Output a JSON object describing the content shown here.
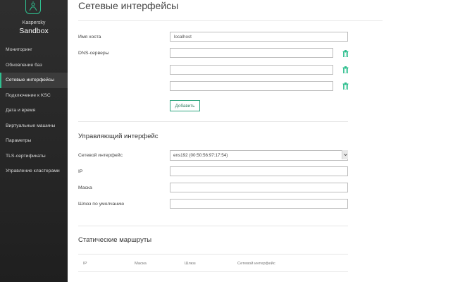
{
  "brand": {
    "company": "Kaspersky",
    "product": "Sandbox",
    "accent": "#2fbf8f"
  },
  "sidebar": {
    "items": [
      {
        "label": "Мониторинг"
      },
      {
        "label": "Обновление баз"
      },
      {
        "label": "Сетевые интерфейсы",
        "active": true
      },
      {
        "label": "Подключение к KSC"
      },
      {
        "label": "Дата и время"
      },
      {
        "label": "Виртуальные машины"
      },
      {
        "label": "Параметры"
      },
      {
        "label": "TLS-сертификаты"
      },
      {
        "label": "Управление кластерами"
      }
    ]
  },
  "page": {
    "title": "Сетевые интерфейсы"
  },
  "hostname": {
    "label": "Имя хоста",
    "value": "localhost"
  },
  "dns": {
    "label": "DNS-серверы",
    "fields": [
      "",
      "",
      ""
    ],
    "add_button": "Добавить"
  },
  "mgmt": {
    "title": "Управляющий интерфейс",
    "iface_label": "Сетевой интерфейс",
    "iface_value": "ens192 (00:50:56:97:17:54)",
    "ip_label": "IP",
    "ip_value": "",
    "mask_label": "Маска",
    "mask_value": "",
    "gateway_label": "Шлюз по умолчанию",
    "gateway_value": ""
  },
  "routes": {
    "title": "Статические маршруты",
    "columns": [
      "IP",
      "Маска",
      "Шлюз",
      "Сетевой интерфейс"
    ]
  },
  "icons": {
    "delete": "trash-icon",
    "logo": "kaspersky-logo-icon",
    "dropdown": "chevron-down-icon"
  }
}
